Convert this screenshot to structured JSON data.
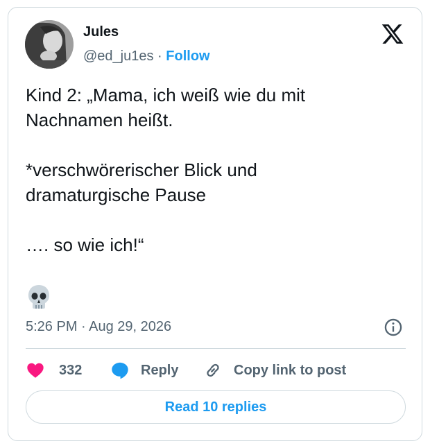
{
  "author": {
    "name": "Jules",
    "handle": "@ed_ju1es",
    "separator": "·",
    "follow_label": "Follow"
  },
  "tweet": {
    "text": "Kind 2: „Mama, ich weiß wie du mit\nNachnamen heißt.\n\n*verschwörerischer Blick und\ndramaturgische Pause\n\n…. so wie ich!“",
    "emoji": "skull",
    "timestamp": "5:26 PM · Aug 29, 2026"
  },
  "actions": {
    "like_count": "332",
    "reply_label": "Reply",
    "copy_link_label": "Copy link to post"
  },
  "read_replies_label": "Read 10 replies",
  "icons": {
    "logo": "x-logo-icon",
    "like": "heart-icon",
    "reply": "speech-bubble-icon",
    "copy": "link-icon",
    "info": "info-icon"
  },
  "colors": {
    "accent": "#1d9bf0",
    "like": "#f91880",
    "muted_text": "#536471",
    "border": "#cfd9de"
  }
}
